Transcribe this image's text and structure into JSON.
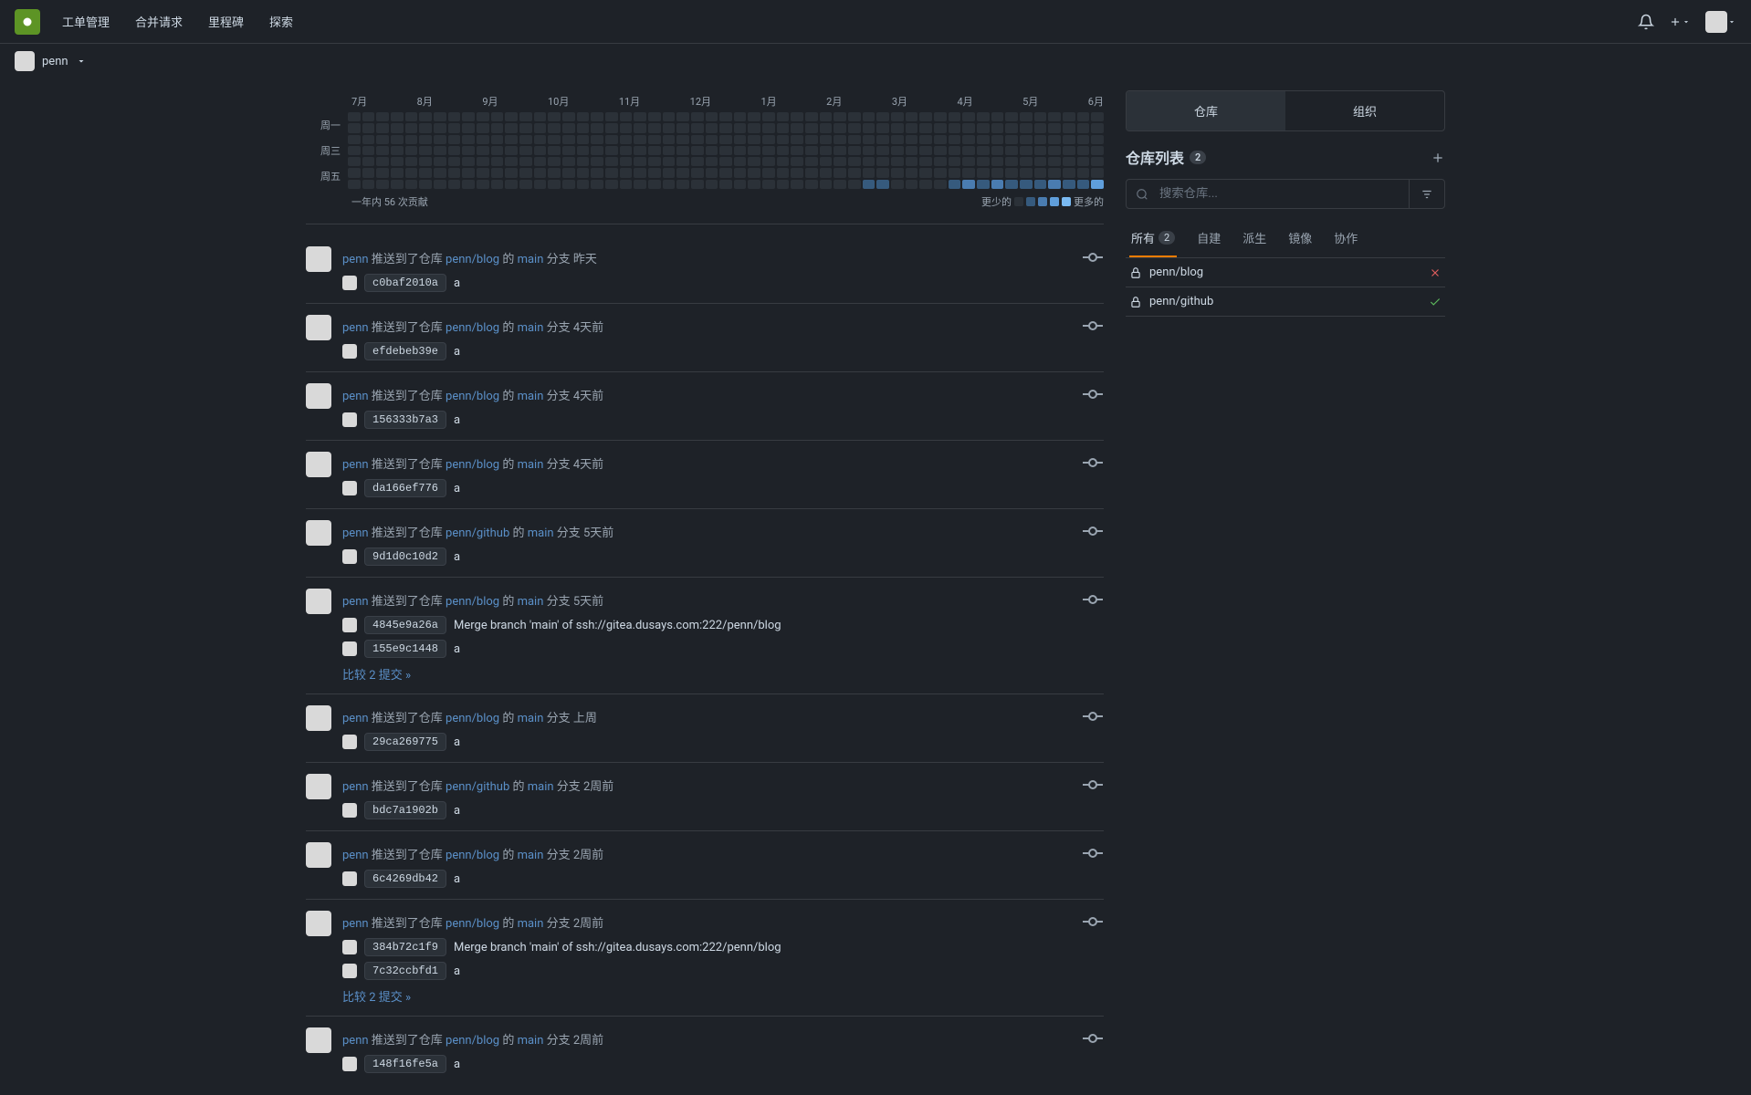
{
  "nav": {
    "issues": "工单管理",
    "pulls": "合并请求",
    "milestones": "里程碑",
    "explore": "探索"
  },
  "user": {
    "name": "penn"
  },
  "heatmap": {
    "months": [
      "7月",
      "8月",
      "9月",
      "10月",
      "11月",
      "12月",
      "1月",
      "2月",
      "3月",
      "4月",
      "5月",
      "6月"
    ],
    "days": [
      "周一",
      "周三",
      "周五"
    ],
    "footer_left": "一年内 56 次贡献",
    "less": "更少的",
    "more": "更多的"
  },
  "activities": [
    {
      "user": "penn",
      "action": "推送到了仓库",
      "repo": "penn/blog",
      "of": "的",
      "branch": "main",
      "branch_suffix": "分支",
      "time": "昨天",
      "commits": [
        {
          "hash": "c0baf2010a",
          "msg": "a"
        }
      ]
    },
    {
      "user": "penn",
      "action": "推送到了仓库",
      "repo": "penn/blog",
      "of": "的",
      "branch": "main",
      "branch_suffix": "分支",
      "time": "4天前",
      "commits": [
        {
          "hash": "efdebeb39e",
          "msg": "a"
        }
      ]
    },
    {
      "user": "penn",
      "action": "推送到了仓库",
      "repo": "penn/blog",
      "of": "的",
      "branch": "main",
      "branch_suffix": "分支",
      "time": "4天前",
      "commits": [
        {
          "hash": "156333b7a3",
          "msg": "a"
        }
      ]
    },
    {
      "user": "penn",
      "action": "推送到了仓库",
      "repo": "penn/blog",
      "of": "的",
      "branch": "main",
      "branch_suffix": "分支",
      "time": "4天前",
      "commits": [
        {
          "hash": "da166ef776",
          "msg": "a"
        }
      ]
    },
    {
      "user": "penn",
      "action": "推送到了仓库",
      "repo": "penn/github",
      "of": "的",
      "branch": "main",
      "branch_suffix": "分支",
      "time": "5天前",
      "commits": [
        {
          "hash": "9d1d0c10d2",
          "msg": "a"
        }
      ]
    },
    {
      "user": "penn",
      "action": "推送到了仓库",
      "repo": "penn/blog",
      "of": "的",
      "branch": "main",
      "branch_suffix": "分支",
      "time": "5天前",
      "commits": [
        {
          "hash": "4845e9a26a",
          "msg": "Merge branch 'main' of ssh://gitea.dusays.com:222/penn/blog"
        },
        {
          "hash": "155e9c1448",
          "msg": "a"
        }
      ],
      "compare": "比较 2 提交 »"
    },
    {
      "user": "penn",
      "action": "推送到了仓库",
      "repo": "penn/blog",
      "of": "的",
      "branch": "main",
      "branch_suffix": "分支",
      "time": "上周",
      "commits": [
        {
          "hash": "29ca269775",
          "msg": "a"
        }
      ]
    },
    {
      "user": "penn",
      "action": "推送到了仓库",
      "repo": "penn/github",
      "of": "的",
      "branch": "main",
      "branch_suffix": "分支",
      "time": "2周前",
      "commits": [
        {
          "hash": "bdc7a1902b",
          "msg": "a"
        }
      ]
    },
    {
      "user": "penn",
      "action": "推送到了仓库",
      "repo": "penn/blog",
      "of": "的",
      "branch": "main",
      "branch_suffix": "分支",
      "time": "2周前",
      "commits": [
        {
          "hash": "6c4269db42",
          "msg": "a"
        }
      ]
    },
    {
      "user": "penn",
      "action": "推送到了仓库",
      "repo": "penn/blog",
      "of": "的",
      "branch": "main",
      "branch_suffix": "分支",
      "time": "2周前",
      "commits": [
        {
          "hash": "384b72c1f9",
          "msg": "Merge branch 'main' of ssh://gitea.dusays.com:222/penn/blog"
        },
        {
          "hash": "7c32ccbfd1",
          "msg": "a"
        }
      ],
      "compare": "比较 2 提交 »"
    },
    {
      "user": "penn",
      "action": "推送到了仓库",
      "repo": "penn/blog",
      "of": "的",
      "branch": "main",
      "branch_suffix": "分支",
      "time": "2周前",
      "commits": [
        {
          "hash": "148f16fe5a",
          "msg": "a"
        }
      ]
    }
  ],
  "sidebar": {
    "tab_repos": "仓库",
    "tab_orgs": "组织",
    "title": "仓库列表",
    "count": "2",
    "search_placeholder": "搜索仓库...",
    "filter_all": "所有",
    "filter_all_count": "2",
    "filter_sources": "自建",
    "filter_forks": "派生",
    "filter_mirrors": "镜像",
    "filter_collab": "协作",
    "repos": [
      {
        "name": "penn/blog",
        "status": "red"
      },
      {
        "name": "penn/github",
        "status": "green"
      }
    ]
  }
}
